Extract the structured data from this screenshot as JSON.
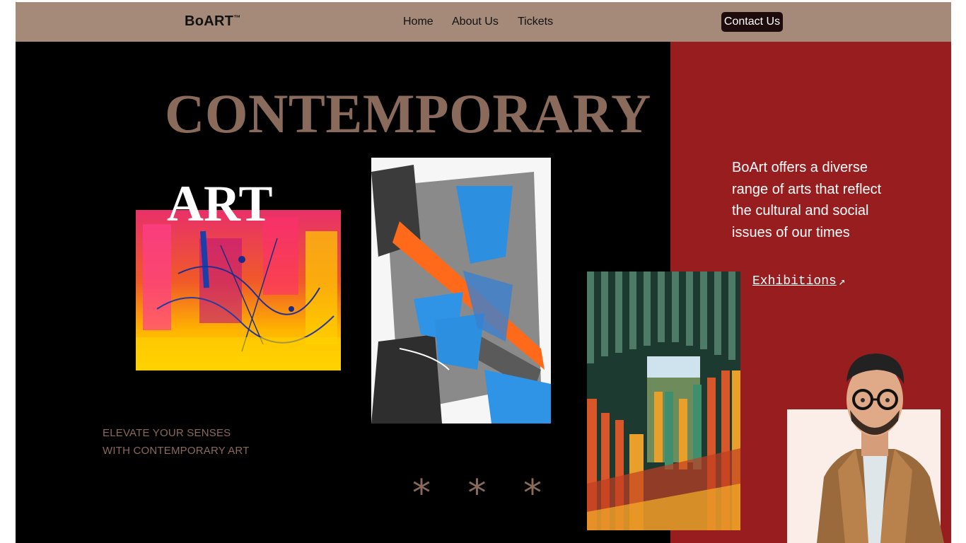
{
  "nav": {
    "logo": "BoART",
    "trademark": "™",
    "links": [
      "Home",
      "About Us",
      "Tickets"
    ],
    "contact_label": "Contact Us"
  },
  "hero": {
    "headline_1": "CONTEMPORARY",
    "headline_2": "ART",
    "tagline_line_1": "ELEVATE YOUR SENSES",
    "tagline_line_2": "WITH CONTEMPORARY ART",
    "stars": "* * *"
  },
  "side": {
    "description": "BoArt offers a diverse range of arts that reflect the cultural and social issues of our times",
    "exhibitions_label": "Exhibitions",
    "exhibitions_icon": "arrow-up-right-icon",
    "arrow_glyph": "↗"
  },
  "colors": {
    "nav_bg": "#a58a7a",
    "brown_accent": "#8a6a5b",
    "red_panel": "#981d1f",
    "contact_bg": "#1e0c0c"
  }
}
